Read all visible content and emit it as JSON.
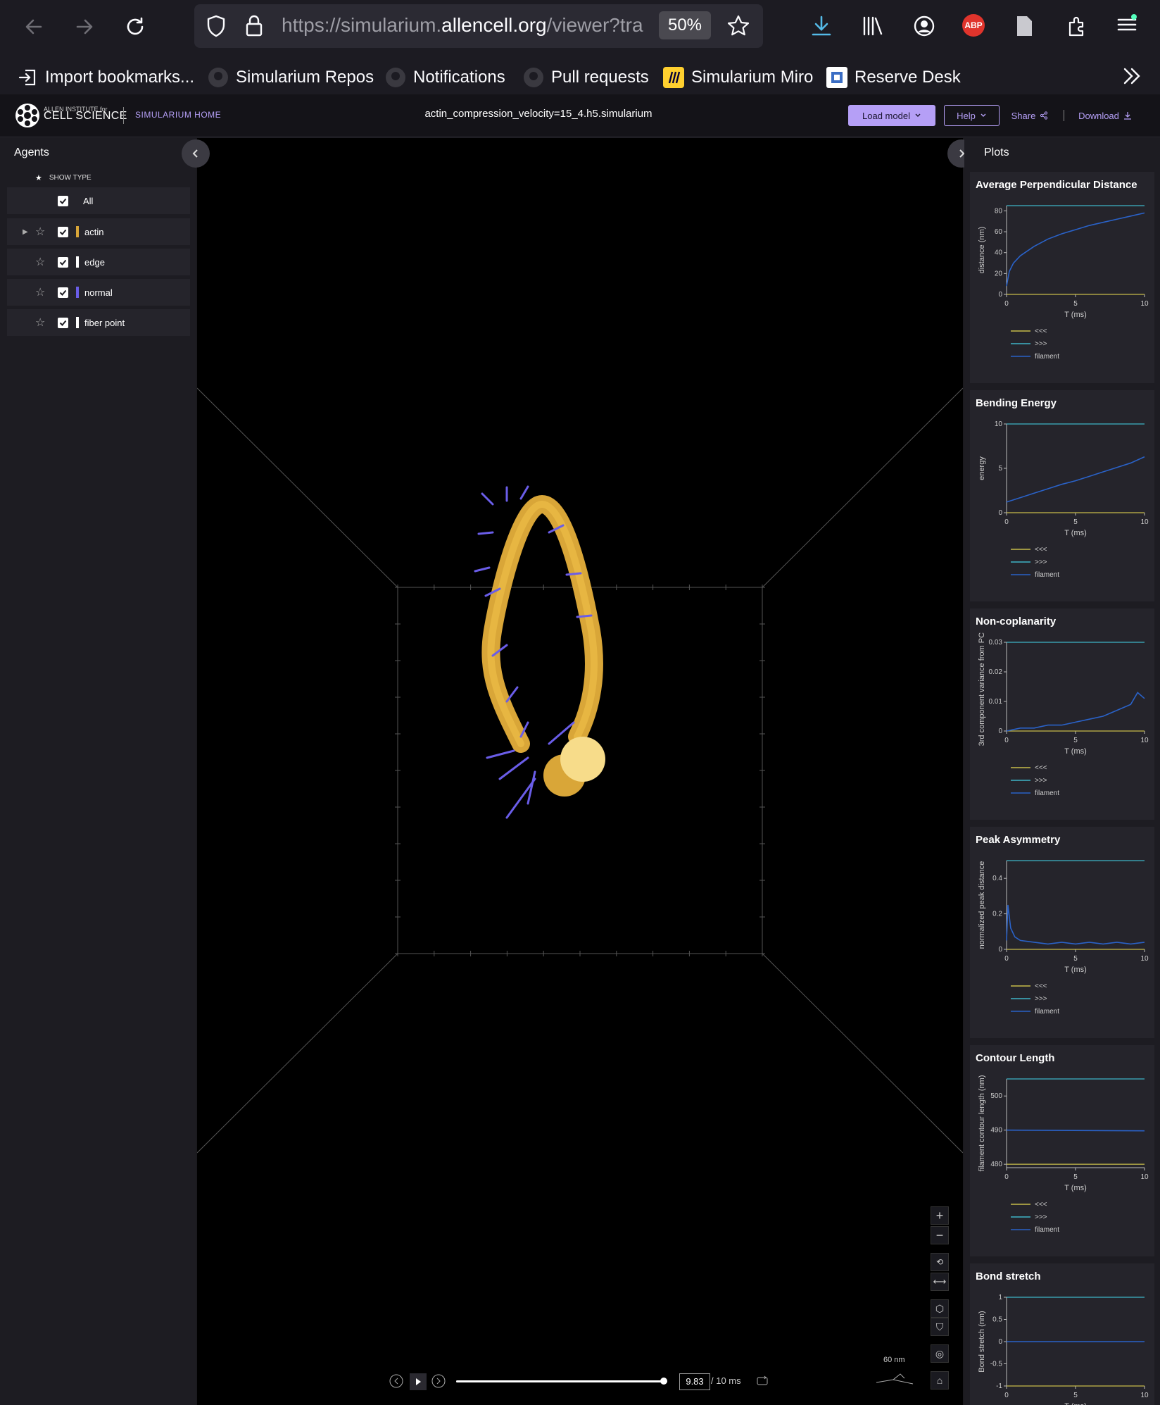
{
  "browser": {
    "url_prefix": "https://simularium.",
    "url_host": "allencell.org",
    "url_rest": "/viewer?tra",
    "zoom": "50%",
    "abp_label": "ABP",
    "bookmarks": [
      {
        "label": "Import bookmarks...",
        "icon": "import-icon"
      },
      {
        "label": "Simularium Repos",
        "icon": "github-icon"
      },
      {
        "label": "Notifications",
        "icon": "github-icon"
      },
      {
        "label": "Pull requests",
        "icon": "github-icon"
      },
      {
        "label": "Simularium Miro",
        "icon": "miro-icon"
      },
      {
        "label": "Reserve Desk",
        "icon": "desk-icon"
      }
    ]
  },
  "header": {
    "logo_small": "ALLEN INSTITUTE for",
    "logo_big": "CELL SCIENCE",
    "home_link": "SIMULARIUM HOME",
    "file_title": "actin_compression_velocity=15_4.h5.simularium",
    "load_model": "Load model",
    "help": "Help",
    "share": "Share",
    "download": "Download",
    "accent": "#b59ff6"
  },
  "agents_panel": {
    "title": "Agents",
    "show_type": "SHOW TYPE",
    "all_label": "All",
    "agents": [
      {
        "label": "actin",
        "color": "#d9a638",
        "expandable": true
      },
      {
        "label": "edge",
        "color": "#ffffff",
        "expandable": false
      },
      {
        "label": "normal",
        "color": "#6a5de8",
        "expandable": false
      },
      {
        "label": "fiber point",
        "color": "#ffffff",
        "expandable": false
      }
    ]
  },
  "plots_panel": {
    "title": "Plots",
    "legend": [
      "<<<",
      ">>>",
      "filament"
    ],
    "legend_colors": [
      "#c6bb4a",
      "#3fb3c7",
      "#2a62c8"
    ],
    "xlabel": "T (ms)",
    "xticks": [
      "0",
      "5",
      "10"
    ]
  },
  "chart_data": [
    {
      "type": "line",
      "title": "Average Perpendicular Distance",
      "xlabel": "T (ms)",
      "ylabel": "distance (nm)",
      "xlim": [
        0,
        10
      ],
      "ylim": [
        0,
        85
      ],
      "yticks": [
        "0",
        "20",
        "40",
        "60",
        "80"
      ],
      "series": [
        {
          "name": "<<<",
          "x": [
            0,
            10
          ],
          "values": [
            0,
            0
          ]
        },
        {
          "name": ">>>",
          "x": [
            0,
            10
          ],
          "values": [
            85,
            85
          ]
        },
        {
          "name": "filament",
          "x": [
            0,
            0.2,
            0.5,
            1,
            2,
            3,
            4,
            5,
            6,
            7,
            8,
            9,
            10
          ],
          "values": [
            8,
            22,
            30,
            37,
            46,
            53,
            58,
            62,
            66,
            69,
            72,
            75,
            78
          ]
        }
      ]
    },
    {
      "type": "line",
      "title": "Bending Energy",
      "xlabel": "T (ms)",
      "ylabel": "energy",
      "xlim": [
        0,
        10
      ],
      "ylim": [
        0,
        10
      ],
      "yticks": [
        "0",
        "5",
        "10"
      ],
      "series": [
        {
          "name": "<<<",
          "x": [
            0,
            10
          ],
          "values": [
            0,
            0
          ]
        },
        {
          "name": ">>>",
          "x": [
            0,
            10
          ],
          "values": [
            10,
            10
          ]
        },
        {
          "name": "filament",
          "x": [
            0,
            1,
            2,
            3,
            4,
            5,
            6,
            7,
            8,
            9,
            10
          ],
          "values": [
            1.2,
            1.7,
            2.2,
            2.7,
            3.2,
            3.6,
            4.1,
            4.6,
            5.1,
            5.6,
            6.3
          ]
        }
      ]
    },
    {
      "type": "line",
      "title": "Non-coplanarity",
      "xlabel": "T (ms)",
      "ylabel": "3rd component variance from PCA",
      "xlim": [
        0,
        10
      ],
      "ylim": [
        0,
        0.03
      ],
      "yticks": [
        "0",
        "0.01",
        "0.02",
        "0.03"
      ],
      "series": [
        {
          "name": "<<<",
          "x": [
            0,
            10
          ],
          "values": [
            0,
            0
          ]
        },
        {
          "name": ">>>",
          "x": [
            0,
            10
          ],
          "values": [
            0.03,
            0.03
          ]
        },
        {
          "name": "filament",
          "x": [
            0,
            1,
            2,
            3,
            4,
            5,
            6,
            7,
            8,
            9,
            9.5,
            10
          ],
          "values": [
            0,
            0.001,
            0.001,
            0.002,
            0.002,
            0.003,
            0.004,
            0.005,
            0.007,
            0.009,
            0.013,
            0.011
          ]
        }
      ]
    },
    {
      "type": "line",
      "title": "Peak Asymmetry",
      "xlabel": "T (ms)",
      "ylabel": "normalized peak distance",
      "xlim": [
        0,
        10
      ],
      "ylim": [
        0,
        0.5
      ],
      "yticks": [
        "0",
        "0.2",
        "0.4"
      ],
      "series": [
        {
          "name": "<<<",
          "x": [
            0,
            10
          ],
          "values": [
            0,
            0
          ]
        },
        {
          "name": ">>>",
          "x": [
            0,
            10
          ],
          "values": [
            0.5,
            0.5
          ]
        },
        {
          "name": "filament",
          "x": [
            0,
            0.1,
            0.3,
            0.6,
            1,
            2,
            3,
            4,
            5,
            6,
            7,
            8,
            9,
            10
          ],
          "values": [
            0.05,
            0.25,
            0.12,
            0.07,
            0.05,
            0.04,
            0.03,
            0.04,
            0.03,
            0.04,
            0.03,
            0.04,
            0.03,
            0.04
          ]
        }
      ]
    },
    {
      "type": "line",
      "title": "Contour Length",
      "xlabel": "T (ms)",
      "ylabel": "filament contour length (nm)",
      "xlim": [
        0,
        10
      ],
      "ylim": [
        479,
        505
      ],
      "yticks": [
        "480",
        "490",
        "500"
      ],
      "series": [
        {
          "name": "<<<",
          "x": [
            0,
            10
          ],
          "values": [
            480,
            480
          ]
        },
        {
          "name": ">>>",
          "x": [
            0,
            10
          ],
          "values": [
            505,
            505
          ]
        },
        {
          "name": "filament",
          "x": [
            0,
            10
          ],
          "values": [
            490,
            489.8
          ]
        }
      ]
    },
    {
      "type": "line",
      "title": "Bond stretch",
      "xlabel": "T (ms)",
      "ylabel": "Bond stretch (nm)",
      "xlim": [
        0,
        10
      ],
      "ylim": [
        -1,
        1
      ],
      "yticks": [
        "-1",
        "-0.5",
        "0",
        "0.5",
        "1"
      ],
      "series": [
        {
          "name": "<<<",
          "x": [
            0,
            10
          ],
          "values": [
            -1,
            -1
          ]
        },
        {
          "name": ">>>",
          "x": [
            0,
            10
          ],
          "values": [
            1,
            1
          ]
        },
        {
          "name": "filament",
          "x": [
            0,
            10
          ],
          "values": [
            0,
            0
          ]
        }
      ]
    }
  ],
  "playback": {
    "current_time": "9.83",
    "total": "/ 10 ms",
    "progress": 0.983
  },
  "scale_bar": "60 nm"
}
